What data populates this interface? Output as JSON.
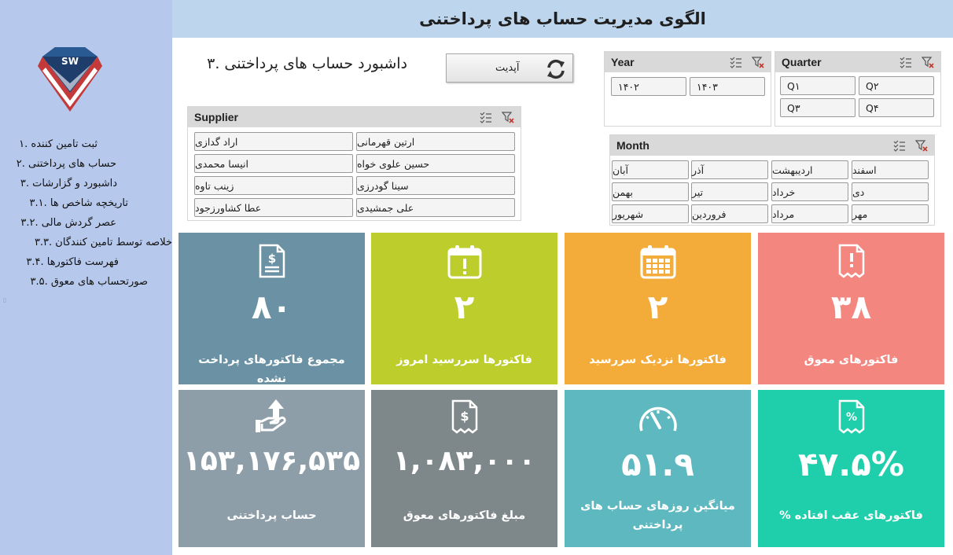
{
  "header": {
    "title": "الگوی مدیریت حساب های پرداختنی"
  },
  "dashboard": {
    "title": "داشبورد حساب های پرداختنی .۳"
  },
  "update_button": {
    "label": "آپدیت",
    "icon": "refresh-icon"
  },
  "sidebar": {
    "logo": {
      "text": "SW",
      "icon": "diamond-logo"
    },
    "items": [
      {
        "label": "ثبت تامین کننده .۱"
      },
      {
        "label": "حساب های پرداختنی .۲"
      },
      {
        "label": "داشبورد و گزارشات .۳"
      },
      {
        "label": "تاریخچه شاخص ها .۳.۱"
      },
      {
        "label": "عصر گردش مالی .۳.۲"
      },
      {
        "label": "خلاصه توسط تامین کنندگان .۳.۳"
      },
      {
        "label": "فهرست فاکتورها .۳.۴"
      },
      {
        "label": "صورتحساب های معوق .۳.۵"
      }
    ]
  },
  "slicers": {
    "supplier": {
      "title": "Supplier",
      "items": [
        "ارتین قهرمانی",
        "اراد گدازی",
        "حسین علوی خواه",
        "انیسا محمدی",
        "سینا گودرزی",
        "زینب تاوه",
        "علی جمشیدی",
        "عطا کشاورزجود"
      ]
    },
    "year": {
      "title": "Year",
      "items": [
        "۱۴۰۲",
        "۱۴۰۳"
      ]
    },
    "quarter": {
      "title": "Quarter",
      "items": [
        "Q۱",
        "Q۲",
        "Q۳",
        "Q۴"
      ]
    },
    "month": {
      "title": "Month",
      "items": [
        "اسفند",
        "اردیبهشت",
        "آذر",
        "آبان",
        "دی",
        "خرداد",
        "تیر",
        "بهمن",
        "مهر",
        "مرداد",
        "فروردین",
        "شهریور"
      ]
    }
  },
  "tiles": [
    {
      "value": "۸۰",
      "label": "مجموع فاکتورهای پرداخت نشده",
      "color": "#6a92a4",
      "icon": "invoice-dollar-icon"
    },
    {
      "value": "۲",
      "label": "فاکتورها سررسید امروز",
      "color": "#bccd2c",
      "icon": "calendar-alert-icon"
    },
    {
      "value": "۲",
      "label": "فاکتورها نزدیک سررسید",
      "color": "#f3ac3a",
      "icon": "calendar-grid-icon"
    },
    {
      "value": "۳۸",
      "label": "فاکتورهای معوق",
      "color": "#f48680",
      "icon": "invoice-alert-icon"
    },
    {
      "value": "۱۵۳,۱۷۶,۵۳۵",
      "label": "حساب پرداختنی",
      "color": "#8e9ea9",
      "icon": "hand-money-icon"
    },
    {
      "value": "۱,۰۸۳,۰۰۰",
      "label": "مبلغ فاکتورهای معوق",
      "color": "#7e8789",
      "icon": "receipt-dollar-icon"
    },
    {
      "value": "۵۱.۹",
      "label": "میانگین روزهای حساب های پرداختنی",
      "color": "#5db8c0",
      "icon": "gauge-icon"
    },
    {
      "value": "۴۷.۵%",
      "label": "فاکتورهای عقب افتاده %",
      "color": "#1fcfab",
      "icon": "percent-invoice-icon"
    }
  ]
}
